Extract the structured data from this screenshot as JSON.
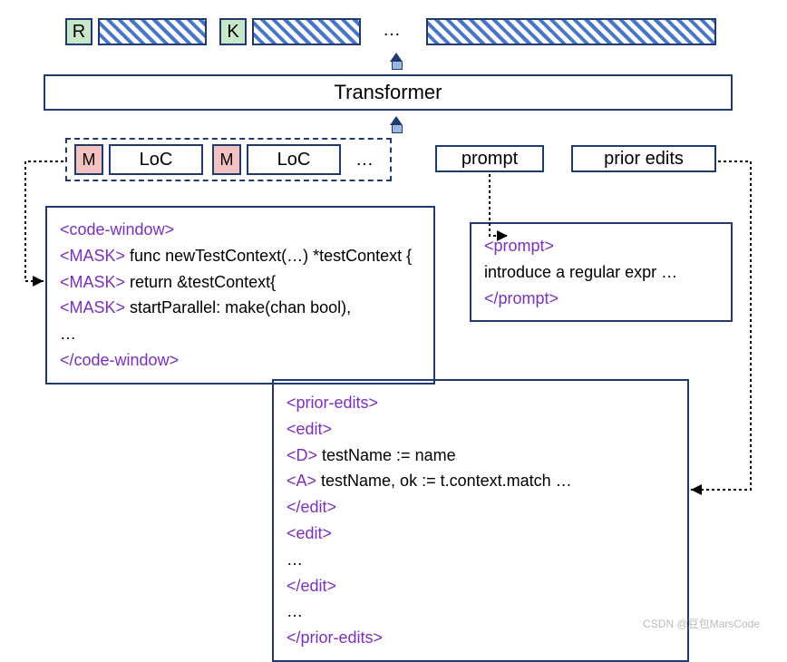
{
  "top": {
    "r_label": "R",
    "k_label": "K",
    "ellipsis": "…"
  },
  "transformer_label": "Transformer",
  "mask_group": {
    "m_label": "M",
    "loc_label": "LoC",
    "ellipsis": "…"
  },
  "input_labels": {
    "prompt": "prompt",
    "prior_edits": "prior edits"
  },
  "code_window": {
    "open": "<code-window>",
    "mask": "<MASK>",
    "line1": " func newTestContext(…) *testContext {",
    "line2": " return &testContext{",
    "line3": " startParallel: make(chan bool),",
    "ellipsis": "…",
    "close": "</code-window>"
  },
  "prompt_box": {
    "open": "<prompt>",
    "text": "introduce a regular expr …",
    "close": "</prompt>"
  },
  "prior_edits_box": {
    "open": "<prior-edits>",
    "edit_open": "<edit>",
    "d": "<D>",
    "d_text": " testName := name",
    "a": "<A>",
    "a_text": " testName, ok := t.context.match …",
    "edit_close": "</edit>",
    "ellipsis": "…",
    "close": "</prior-edits>"
  },
  "watermark": "CSDN @豆包MarsCode"
}
